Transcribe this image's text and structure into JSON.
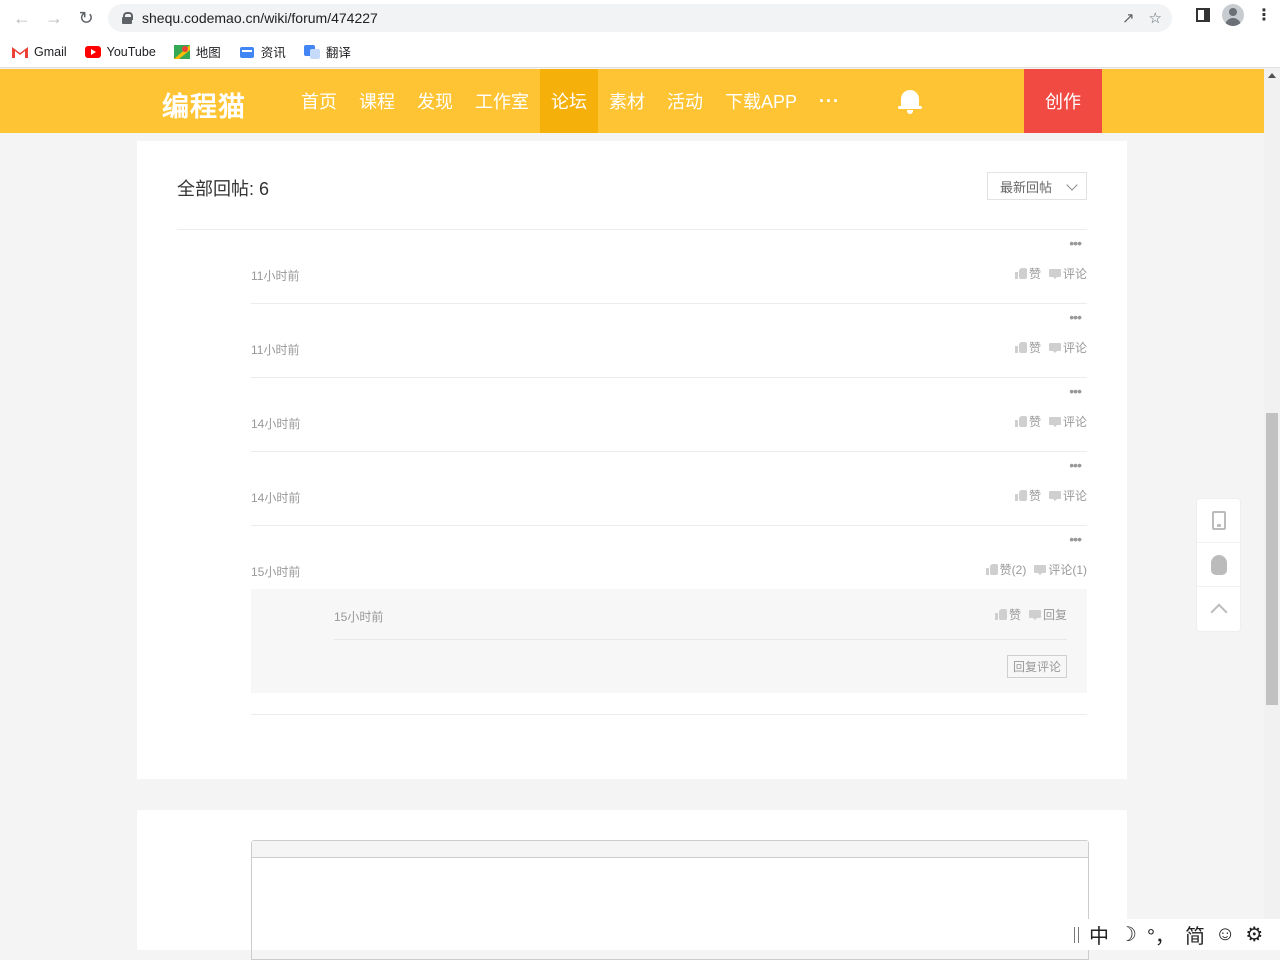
{
  "browser": {
    "url": "shequ.codemao.cn/wiki/forum/474227",
    "bookmarks": [
      {
        "label": "Gmail",
        "icon": "gmail-icon"
      },
      {
        "label": "YouTube",
        "icon": "youtube-icon"
      },
      {
        "label": "地图",
        "icon": "maps-icon"
      },
      {
        "label": "资讯",
        "icon": "news-icon"
      },
      {
        "label": "翻译",
        "icon": "translate-icon"
      }
    ]
  },
  "header": {
    "logo": "编程猫",
    "menu": [
      "首页",
      "课程",
      "发现",
      "工作室",
      "论坛",
      "素材",
      "活动",
      "下载APP",
      "···"
    ],
    "active_menu": "论坛",
    "create_label": "创作",
    "colors": {
      "bar": "#fec433",
      "active": "#f5b00a",
      "create": "#f04a43"
    }
  },
  "replies": {
    "title": "全部回帖: 6",
    "sort_label": "最新回帖",
    "items": [
      {
        "time": "11小时前",
        "like": "赞",
        "comment": "评论"
      },
      {
        "time": "11小时前",
        "like": "赞",
        "comment": "评论"
      },
      {
        "time": "14小时前",
        "like": "赞",
        "comment": "评论"
      },
      {
        "time": "14小时前",
        "like": "赞",
        "comment": "评论"
      },
      {
        "time": "15小时前",
        "like": "赞(2)",
        "comment": "评论(1)"
      }
    ],
    "sub_comment": {
      "time": "15小时前",
      "like": "赞",
      "reply": "回复",
      "reply_button": "回复评论"
    }
  },
  "ime": {
    "lang": "中",
    "moon": "☽",
    "punct": "°，",
    "mode": "简",
    "emoji": "☺",
    "settings": "⚙"
  }
}
